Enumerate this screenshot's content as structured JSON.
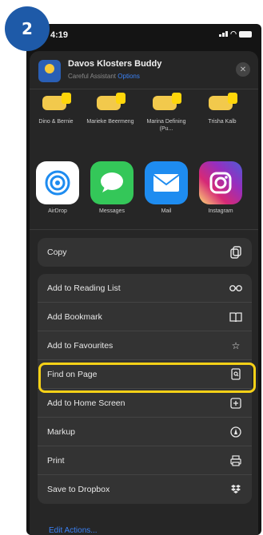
{
  "step_badge": "2",
  "status_bar": {
    "time": "4:19"
  },
  "share_header": {
    "title": "Davos Klosters Buddy",
    "subtitle": "Careful Assistant",
    "options_label": "Options"
  },
  "contacts": [
    {
      "name": "Dino & Bernie"
    },
    {
      "name": "Marieke Beermeng"
    },
    {
      "name": "Marina Defining (Pu..."
    },
    {
      "name": "Trisha Kalb"
    }
  ],
  "apps": [
    {
      "label": "AirDrop",
      "icon": "airdrop-icon",
      "color": "#ffffff"
    },
    {
      "label": "Messages",
      "icon": "messages-icon",
      "color": "#34c759"
    },
    {
      "label": "Mail",
      "icon": "mail-icon",
      "color": "#1e8cf0"
    },
    {
      "label": "Instagram",
      "icon": "instagram-icon",
      "color": "#d62976"
    }
  ],
  "actions": {
    "copy": {
      "label": "Copy",
      "icon": "copy-icon"
    },
    "reading_list": {
      "label": "Add to Reading List",
      "icon": "glasses-icon"
    },
    "bookmark": {
      "label": "Add Bookmark",
      "icon": "book-icon"
    },
    "favourites": {
      "label": "Add to Favourites",
      "icon": "star-icon"
    },
    "find": {
      "label": "Find on Page",
      "icon": "find-doc-icon"
    },
    "home_screen": {
      "label": "Add to Home Screen",
      "icon": "plus-square-icon"
    },
    "markup": {
      "label": "Markup",
      "icon": "markup-pen-icon"
    },
    "print": {
      "label": "Print",
      "icon": "printer-icon"
    },
    "dropbox": {
      "label": "Save to Dropbox",
      "icon": "dropbox-icon"
    }
  },
  "edit_actions": "Edit Actions...",
  "colors": {
    "highlight": "#f7d117",
    "badge": "#1e5aa8",
    "link": "#3b82f6"
  }
}
